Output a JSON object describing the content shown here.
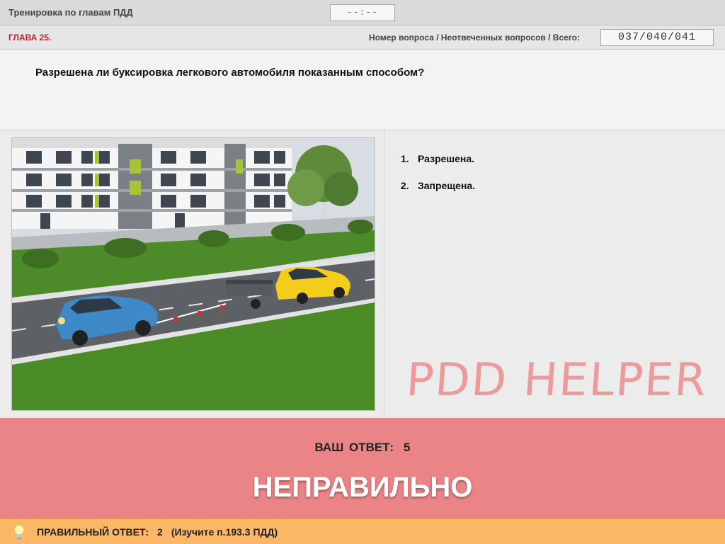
{
  "titlebar": {
    "title": "Тренировка по главам ПДД",
    "timer": "--:--"
  },
  "header": {
    "chapter": "ГЛАВА 25.",
    "counter_label": "Номер вопроса / Неотвеченных вопросов / Всего:",
    "counter_value": "037/040/041"
  },
  "question": {
    "text": "Разрешена ли буксировка легкового автомобиля показанным способом?"
  },
  "answers": [
    {
      "num": "1.",
      "text": "Разрешена."
    },
    {
      "num": "2.",
      "text": "Запрещена."
    }
  ],
  "watermark": "PDD HELPER",
  "result": {
    "your_answer_label": "ВАШ ОТВЕТ:",
    "your_answer_value": "5",
    "verdict": "НЕПРАВИЛЬНО"
  },
  "footer": {
    "correct_label": "ПРАВИЛЬНЫЙ ОТВЕТ:",
    "correct_value": "2",
    "hint": "(Изучите п.193.3 ПДД)"
  },
  "icons": {
    "hint": "lightbulb-icon",
    "image": "question-illustration"
  },
  "colors": {
    "chapter": "#b8232a",
    "result_bg": "#ea8486",
    "footer_bg": "#fbb765",
    "watermark": "#ec8e8e"
  }
}
